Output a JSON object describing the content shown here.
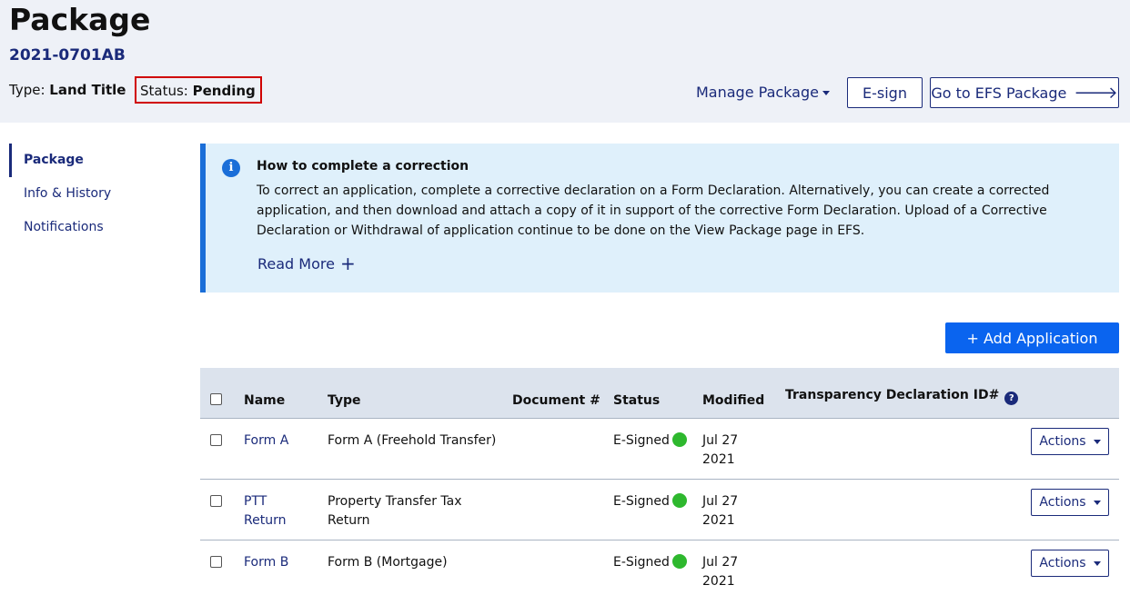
{
  "header": {
    "title": "Package",
    "package_id": "2021-0701AB",
    "type_label": "Type:",
    "type_value": "Land Title",
    "status_label": "Status:",
    "status_value": "Pending",
    "manage_label": "Manage Package",
    "esign_label": "E-sign",
    "efs_label": "Go to EFS Package",
    "highlight_color": "#d00000"
  },
  "sidenav": {
    "items": [
      {
        "label": "Package",
        "active": true
      },
      {
        "label": "Info & History",
        "active": false
      },
      {
        "label": "Notifications",
        "active": false
      }
    ]
  },
  "info": {
    "title": "How to complete a correction",
    "body": "To correct an application, complete a corrective declaration on a Form Declaration. Alternatively, you can create a corrected application, and then download and attach a copy of it in support of the corrective Form Declaration. Upload of a Corrective Declaration or Withdrawal of application continue to be done on the View Package page in EFS.",
    "read_more": "Read More",
    "accent_color": "#1a6ed8"
  },
  "add_button": "+ Add Application",
  "table": {
    "headers": {
      "name": "Name",
      "type": "Type",
      "document": "Document #",
      "status": "Status",
      "modified": "Modified",
      "transparency": "Transparency Declaration ID#"
    },
    "rows": [
      {
        "name": "Form A",
        "type": "Form A (Freehold Transfer)",
        "document": "",
        "status": "E-Signed",
        "modified_1": "Jul 27",
        "modified_2": "2021",
        "actions": "Actions"
      },
      {
        "name_1": "PTT",
        "name_2": "Return",
        "type_1": "Property Transfer Tax",
        "type_2": "Return",
        "document": "",
        "status": "E-Signed",
        "modified_1": "Jul 27",
        "modified_2": "2021",
        "actions": "Actions"
      },
      {
        "name": "Form B",
        "type": "Form B (Mortgage)",
        "document": "",
        "status": "E-Signed",
        "modified_1": "Jul 27",
        "modified_2": "2021",
        "actions": "Actions"
      }
    ],
    "status_color": "#2eb82e"
  }
}
